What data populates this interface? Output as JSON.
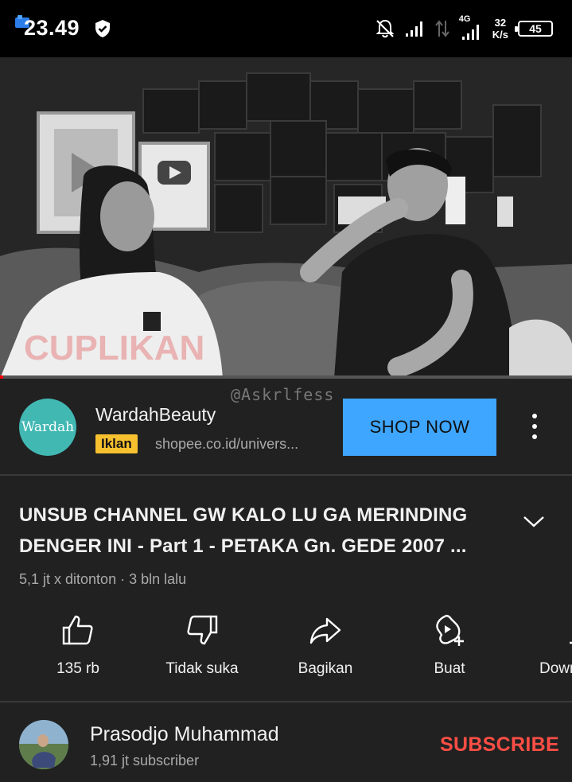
{
  "status_bar": {
    "time": "23.49",
    "network": "4G",
    "speed_value": "32",
    "speed_unit": "K/s",
    "battery": "45"
  },
  "video": {
    "watermark": "@Askrlfess",
    "progress": 0.005
  },
  "ad": {
    "logo_text": "Wardah",
    "advertiser": "WardahBeauty",
    "badge": "Iklan",
    "url": "shopee.co.id/univers...",
    "cta": "SHOP NOW",
    "cta_color": "#3ea6ff",
    "badge_color": "#f6c02f"
  },
  "video_info": {
    "title": "UNSUB CHANNEL GW KALO LU GA MERINDING DENGER INI - Part 1 - PETAKA Gn. GEDE 2007 ...",
    "meta": "5,1 jt x ditonton · 3 bln lalu"
  },
  "actions": [
    {
      "icon": "thumbs-up-icon",
      "label": "135 rb"
    },
    {
      "icon": "thumbs-down-icon",
      "label": "Tidak suka"
    },
    {
      "icon": "share-icon",
      "label": "Bagikan"
    },
    {
      "icon": "create-icon",
      "label": "Buat"
    },
    {
      "icon": "download-icon",
      "label": "Down"
    }
  ],
  "channel": {
    "name": "Prasodjo Muhammad",
    "subscribers": "1,91 jt subscriber",
    "subscribe_label": "SUBSCRIBE",
    "subscribe_color": "#ff4e45"
  }
}
